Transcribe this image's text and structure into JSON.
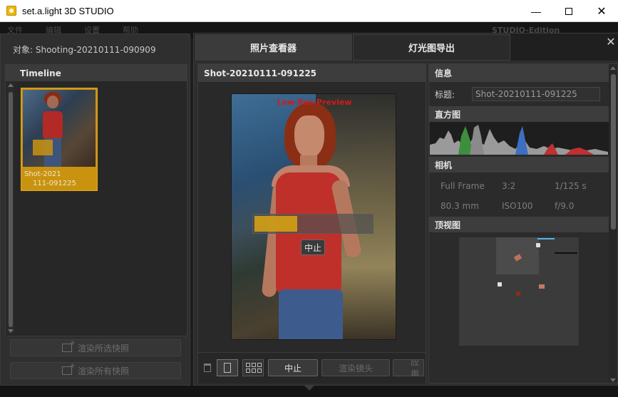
{
  "window": {
    "title": "set.a.light 3D STUDIO",
    "minimize": "—",
    "close": "✕"
  },
  "menubar": {
    "items": [
      "文件",
      "编辑",
      "设置",
      "帮助"
    ],
    "edition": "STUDIO-Edition"
  },
  "left": {
    "object_label": "对象: Shooting-20210111-090909",
    "timeline_title": "Timeline",
    "snapshot_caption_1": "Shot-2021",
    "snapshot_caption_2": "111-091225",
    "render_selected": "渲染所选快照",
    "render_all": "渲染所有快照"
  },
  "tabs": {
    "photo_viewer": "照片查看器",
    "lighting_export": "灯光图导出",
    "close": "✕"
  },
  "viewer": {
    "title": "Shot-20210111-091225",
    "overlay": "Low-Res Preview",
    "progress": 0.36,
    "stop_overlay": "中止",
    "stop": "中止",
    "render_lens": "渲染镜头",
    "apply": "应用"
  },
  "info": {
    "section_info": "信息",
    "title_label": "标题:",
    "title_value": "Shot-20210111-091225",
    "section_histogram": "直方图",
    "section_camera": "相机",
    "camera": {
      "format": "Full Frame",
      "ratio": "3:2",
      "shutter": "1/125 s",
      "focal": "80.3 mm",
      "iso": "ISO100",
      "aperture": "f/9.0"
    },
    "section_topview": "顶视图"
  },
  "colors": {
    "accent_gold": "#d4a015",
    "lowres_red": "#d11a1a",
    "histogram_blue": "#3d6fc0",
    "histogram_green": "#3d8f3d",
    "histogram_red": "#c03030"
  }
}
